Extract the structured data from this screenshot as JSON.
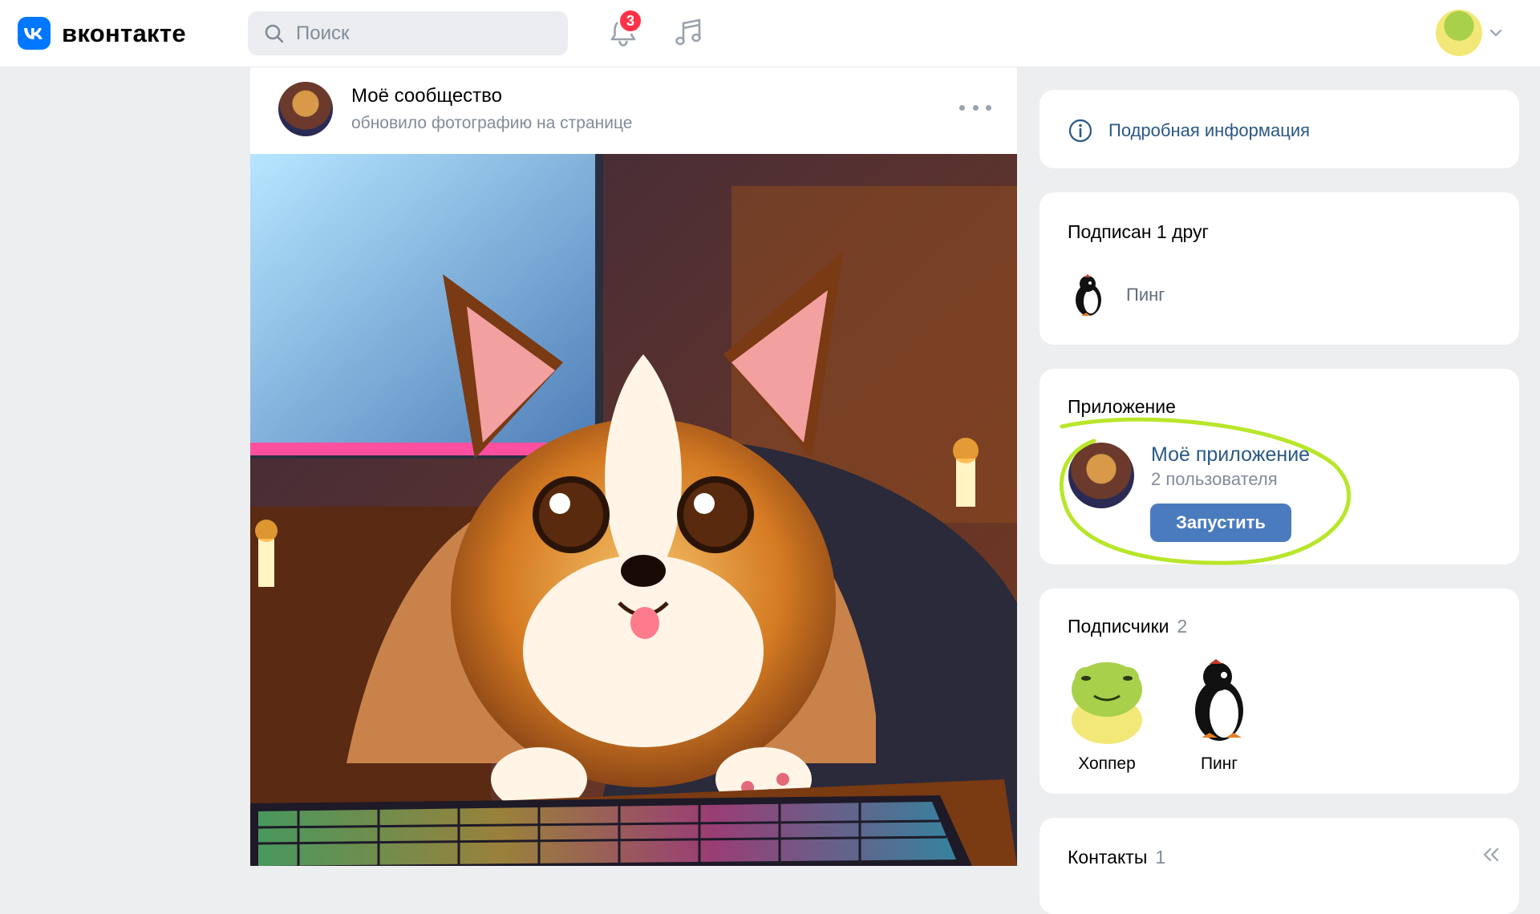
{
  "header": {
    "logo_text": "вконтакте",
    "search_placeholder": "Поиск",
    "notifications_count": "3",
    "brand_color": "#0077ff"
  },
  "post": {
    "author": "Моё сообщество",
    "action": "обновило фотографию на странице"
  },
  "sidebar": {
    "info_label": "Подробная информация",
    "friends": {
      "title": "Подписан 1 друг",
      "items": [
        {
          "name": "Пинг"
        }
      ]
    },
    "app": {
      "title": "Приложение",
      "name": "Моё приложение",
      "users": "2 пользователя",
      "launch_label": "Запустить"
    },
    "subscribers": {
      "title": "Подписчики",
      "count": "2",
      "items": [
        {
          "name": "Хоппер"
        },
        {
          "name": "Пинг"
        }
      ]
    },
    "contacts": {
      "title": "Контакты",
      "count": "1"
    }
  },
  "colors": {
    "link": "#2a5885",
    "button": "#4a7bbf",
    "badge": "#ff3347",
    "annotation": "#b8e62a"
  }
}
